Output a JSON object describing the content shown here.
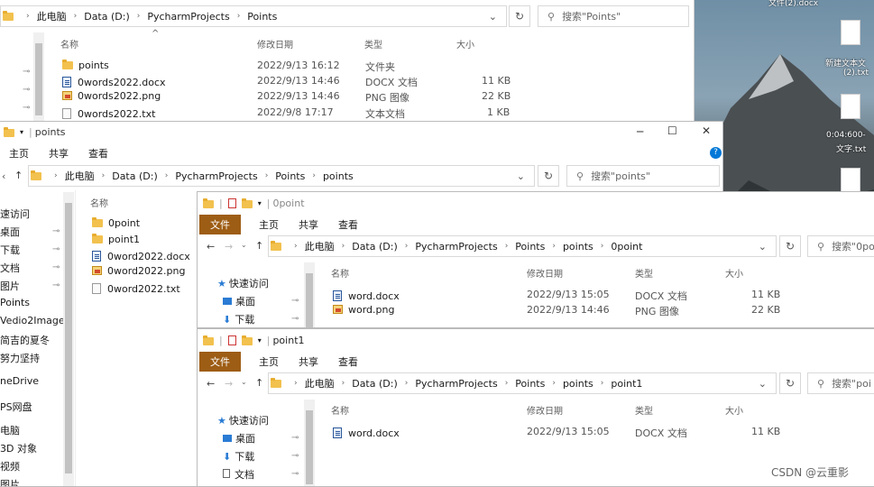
{
  "desktop": {
    "top_text": "文件(2).docx",
    "icon1_label_line1": "新建文本文",
    "icon1_label_line2": "(2).txt",
    "icon2_label_line1": "0:04:600-",
    "icon2_label_line2": "文字.txt"
  },
  "win1": {
    "path": [
      "此电脑",
      "Data (D:)",
      "PycharmProjects",
      "Points"
    ],
    "search_placeholder": "搜索\"Points\"",
    "columns": {
      "name": "名称",
      "date": "修改日期",
      "type": "类型",
      "size": "大小"
    },
    "files": [
      {
        "name": "points",
        "date": "2022/9/13 16:12",
        "type": "文件夹",
        "size": "",
        "icon": "folder"
      },
      {
        "name": "0words2022.docx",
        "date": "2022/9/13 14:46",
        "type": "DOCX 文档",
        "size": "11 KB",
        "icon": "docx"
      },
      {
        "name": "0words2022.png",
        "date": "2022/9/13 14:46",
        "type": "PNG 图像",
        "size": "22 KB",
        "icon": "png"
      },
      {
        "name": "0words2022.txt",
        "date": "2022/9/8 17:17",
        "type": "文本文档",
        "size": "1 KB",
        "icon": "txt"
      }
    ]
  },
  "win2": {
    "title": "points",
    "ribbon": [
      "主页",
      "共享",
      "查看"
    ],
    "path": [
      "此电脑",
      "Data (D:)",
      "PycharmProjects",
      "Points",
      "points"
    ],
    "search_placeholder": "搜索\"points\"",
    "nav": [
      "速访问",
      "桌面",
      "下载",
      "文档",
      "图片",
      "Points",
      "Vedio2Image",
      "简吉的夏冬",
      "努力坚持",
      "neDrive",
      "PS网盘",
      "电脑",
      "3D 对象",
      "视频",
      "图片"
    ],
    "column_name": "名称",
    "files": [
      {
        "name": "0point",
        "icon": "folder"
      },
      {
        "name": "point1",
        "icon": "folder"
      },
      {
        "name": "0word2022.docx",
        "icon": "docx"
      },
      {
        "name": "0word2022.png",
        "icon": "png"
      },
      {
        "name": "0word2022.txt",
        "icon": "txt"
      }
    ]
  },
  "win3": {
    "title": "0point",
    "ribbon": [
      "文件",
      "主页",
      "共享",
      "查看"
    ],
    "path": [
      "此电脑",
      "Data (D:)",
      "PycharmProjects",
      "Points",
      "points",
      "0point"
    ],
    "search_placeholder": "搜索\"0po",
    "nav": [
      "快速访问",
      "桌面",
      "下载"
    ],
    "columns": {
      "name": "名称",
      "date": "修改日期",
      "type": "类型",
      "size": "大小"
    },
    "files": [
      {
        "name": "word.docx",
        "date": "2022/9/13 15:05",
        "type": "DOCX 文档",
        "size": "11 KB",
        "icon": "docx"
      },
      {
        "name": "word.png",
        "date": "2022/9/13 14:46",
        "type": "PNG 图像",
        "size": "22 KB",
        "icon": "png"
      }
    ]
  },
  "win4": {
    "title": "point1",
    "ribbon": [
      "文件",
      "主页",
      "共享",
      "查看"
    ],
    "path": [
      "此电脑",
      "Data (D:)",
      "PycharmProjects",
      "Points",
      "points",
      "point1"
    ],
    "search_placeholder": "搜索\"poi",
    "nav": [
      "快速访问",
      "桌面",
      "下载",
      "文档"
    ],
    "columns": {
      "name": "名称",
      "date": "修改日期",
      "type": "类型",
      "size": "大小"
    },
    "files": [
      {
        "name": "word.docx",
        "date": "2022/9/13 15:05",
        "type": "DOCX 文档",
        "size": "11 KB",
        "icon": "docx"
      }
    ]
  },
  "watermark": "CSDN @云重影",
  "colors": {
    "file_tab": "#9d5d15",
    "folder": "#f2c14e",
    "accent_blue": "#0078d7"
  }
}
